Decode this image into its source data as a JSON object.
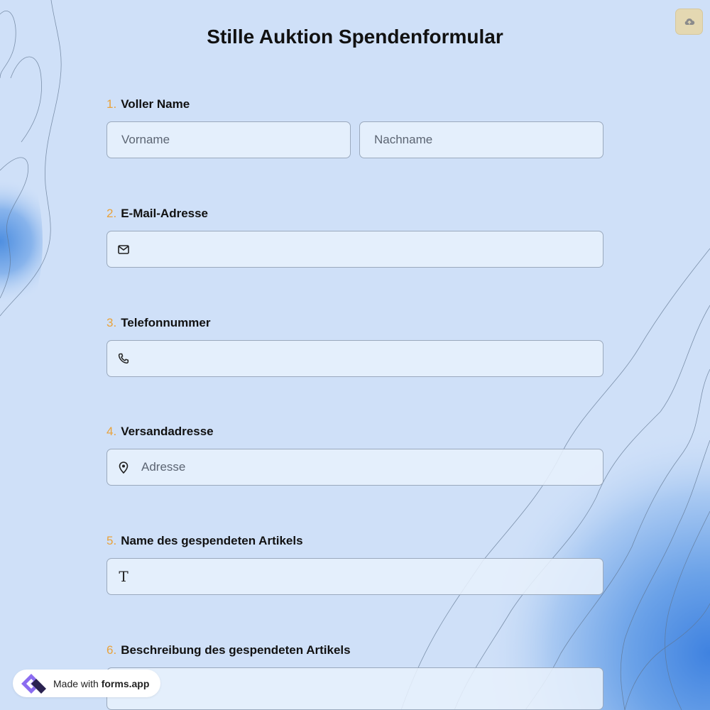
{
  "header": {
    "title": "Stille Auktion Spendenformular",
    "save_icon": "cloud-upload-icon"
  },
  "questions": [
    {
      "number": "1.",
      "label": "Voller Name",
      "fields": [
        {
          "placeholder": "Vorname",
          "value": ""
        },
        {
          "placeholder": "Nachname",
          "value": ""
        }
      ]
    },
    {
      "number": "2.",
      "label": "E-Mail-Adresse",
      "icon": "envelope-icon",
      "placeholder": "",
      "value": ""
    },
    {
      "number": "3.",
      "label": "Telefonnummer",
      "icon": "phone-icon",
      "placeholder": "",
      "value": ""
    },
    {
      "number": "4.",
      "label": "Versandadresse",
      "icon": "location-pin-icon",
      "placeholder": "Adresse",
      "value": ""
    },
    {
      "number": "5.",
      "label": "Name des gespendeten Artikels",
      "icon": "text-t-icon",
      "icon_glyph": "T",
      "placeholder": "",
      "value": ""
    },
    {
      "number": "6.",
      "label": "Beschreibung des gespendeten Artikels",
      "placeholder": "",
      "value": ""
    }
  ],
  "footer": {
    "badge_prefix": "Made with",
    "badge_brand": "forms.app",
    "badge_icon": "forms-app-logo-icon"
  },
  "colors": {
    "background": "#cfe0f8",
    "question_number": "#e9a23b",
    "save_button": "#e4d8b2",
    "field_background": "#e7f0fc",
    "field_border": "#9aa9bd"
  }
}
